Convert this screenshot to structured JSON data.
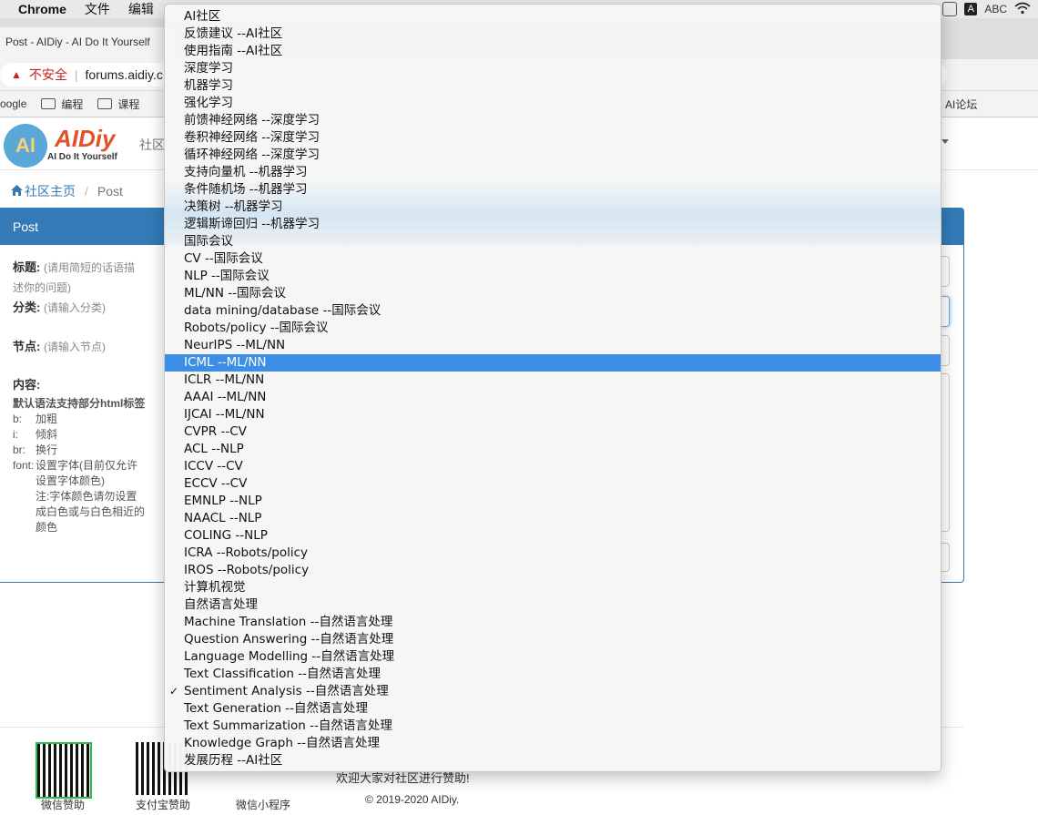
{
  "menubar": {
    "app": "Chrome",
    "items": [
      "文件",
      "编辑"
    ],
    "right_ime": "A",
    "right_input": "ABC"
  },
  "browser": {
    "tab_title": "Post - AIDiy - AI Do It Yourself",
    "insecure_label": "不安全",
    "url": "forums.aidiy.c",
    "bookmarks": [
      "oogle",
      "编程",
      "课程"
    ],
    "bookmark_right": "AI论坛"
  },
  "site": {
    "logo_mark": "AI",
    "logo_text": "AIDiy",
    "logo_sub": "AI Do It Yourself",
    "nav_item": "社区"
  },
  "breadcrumb": {
    "home": "社区主页",
    "current": "Post"
  },
  "panel": {
    "title": "Post",
    "fields": {
      "title_label": "标题:",
      "title_placeholder": "(请用简短的话语描",
      "title_placeholder_2": "述你的问题)",
      "category_label": "分类:",
      "category_placeholder": "(请输入分类)",
      "node_label": "节点:",
      "node_placeholder": "(请输入节点)",
      "content_label": "内容:"
    },
    "help": {
      "title": "默认语法支持部分html标签",
      "rows": [
        {
          "k": "b:",
          "v": "加粗"
        },
        {
          "k": "i:",
          "v": "倾斜"
        },
        {
          "k": "br:",
          "v": "换行"
        },
        {
          "k": "font:",
          "v": "设置字体(目前仅允许"
        }
      ],
      "font_cont": [
        "设置字体颜色)",
        "注:字体颜色请勿设置",
        "成白色或与白色相近的",
        "颜色"
      ]
    }
  },
  "footer": {
    "qr_labels": [
      "微信赞助",
      "支付宝赞助",
      "微信小程序"
    ],
    "text": "欢迎大家对社区进行赞助!",
    "copyright": "© 2019-2020 AIDiy."
  },
  "dropdown": {
    "selected_index": 20,
    "checked_index": 39,
    "options": [
      "AI社区",
      "反馈建议 --AI社区",
      "使用指南 --AI社区",
      "深度学习",
      "机器学习",
      "强化学习",
      "前馈神经网络 --深度学习",
      "卷积神经网络 --深度学习",
      "循环神经网络 --深度学习",
      "支持向量机 --机器学习",
      "条件随机场 --机器学习",
      "决策树 --机器学习",
      "逻辑斯谛回归 --机器学习",
      "国际会议",
      "CV --国际会议",
      "NLP --国际会议",
      "ML/NN --国际会议",
      "data mining/database --国际会议",
      "Robots/policy --国际会议",
      "NeurIPS --ML/NN",
      "ICML --ML/NN",
      "ICLR --ML/NN",
      "AAAI --ML/NN",
      "IJCAI --ML/NN",
      "CVPR --CV",
      "ACL --NLP",
      "ICCV --CV",
      "ECCV --CV",
      "EMNLP --NLP",
      "NAACL --NLP",
      "COLING --NLP",
      "ICRA --Robots/policy",
      "IROS --Robots/policy",
      "计算机视觉",
      "自然语言处理",
      "Machine Translation --自然语言处理",
      "Question Answering --自然语言处理",
      "Language Modelling --自然语言处理",
      "Text Classification --自然语言处理",
      "Sentiment Analysis --自然语言处理",
      "Text Generation --自然语言处理",
      "Text Summarization --自然语言处理",
      "Knowledge Graph --自然语言处理",
      "发展历程 --AI社区"
    ]
  }
}
